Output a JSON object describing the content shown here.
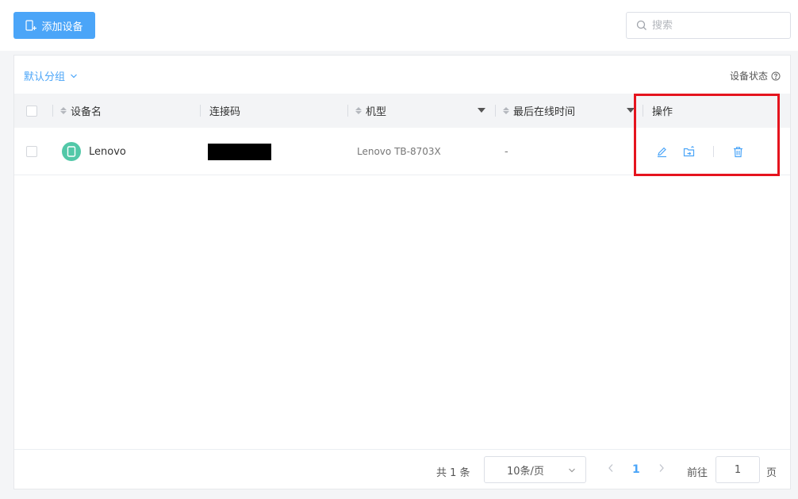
{
  "toolbar": {
    "add_device_label": "添加设备",
    "search_placeholder": "搜索"
  },
  "card": {
    "group_label": "默认分组",
    "device_status_label": "设备状态"
  },
  "table": {
    "columns": [
      "设备名",
      "连接码",
      "机型",
      "最后在线时间",
      "操作"
    ],
    "rows": [
      {
        "device_name": "Lenovo",
        "connection_code": "",
        "model": "Lenovo TB-8703X",
        "last_online": "-"
      }
    ]
  },
  "pagination": {
    "total_text": "共 1 条",
    "page_size": "10条/页",
    "current_page": "1",
    "goto_label": "前往",
    "goto_value": "1",
    "page_unit": "页"
  },
  "colors": {
    "accent": "#4ba5f8",
    "device_icon": "#52c8a8",
    "highlight_box": "#e5141e"
  }
}
